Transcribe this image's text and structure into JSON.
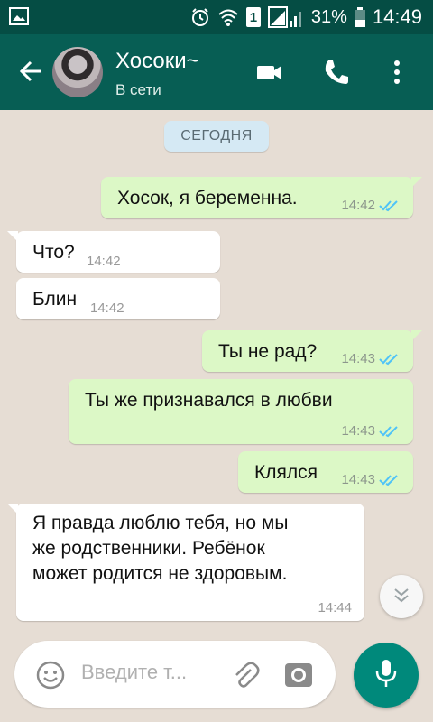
{
  "status_bar": {
    "battery_percent": "31%",
    "time": "14:49",
    "sim_badge": "1"
  },
  "header": {
    "contact_name": "Хосоки~",
    "contact_status": "В сети"
  },
  "chat": {
    "date_label": "СЕГОДНЯ",
    "messages": [
      {
        "direction": "out",
        "text": "Хосок, я беременна.",
        "time": "14:42",
        "read": true
      },
      {
        "direction": "in",
        "text": "Что?",
        "time": "14:42"
      },
      {
        "direction": "in",
        "text": "Блин",
        "time": "14:42"
      },
      {
        "direction": "out",
        "text": "Ты не рад?",
        "time": "14:43",
        "read": true
      },
      {
        "direction": "out",
        "text": "Ты же признавался в любви",
        "time": "14:43",
        "read": true
      },
      {
        "direction": "out",
        "text": "Клялся",
        "time": "14:43",
        "read": true
      },
      {
        "direction": "in",
        "text_lines": [
          "Я правда люблю тебя, но мы",
          "же родственники. Ребёнок",
          "может родится не здоровым."
        ],
        "time": "14:44"
      }
    ]
  },
  "composer": {
    "placeholder": "Введите т..."
  },
  "colors": {
    "header": "#075e54",
    "status_bar": "#054d44",
    "outgoing_bubble": "#dcf8c6",
    "incoming_bubble": "#ffffff",
    "read_ticks": "#4fc3f7",
    "mic_button": "#00897b"
  },
  "icons": [
    "gallery-icon",
    "alarm-icon",
    "wifi-icon",
    "sim-icon",
    "signal-icon",
    "battery-icon",
    "back-arrow-icon",
    "video-call-icon",
    "phone-call-icon",
    "more-vert-icon",
    "double-check-icon",
    "chevron-down-icon",
    "emoji-icon",
    "attach-icon",
    "camera-icon",
    "mic-icon"
  ]
}
